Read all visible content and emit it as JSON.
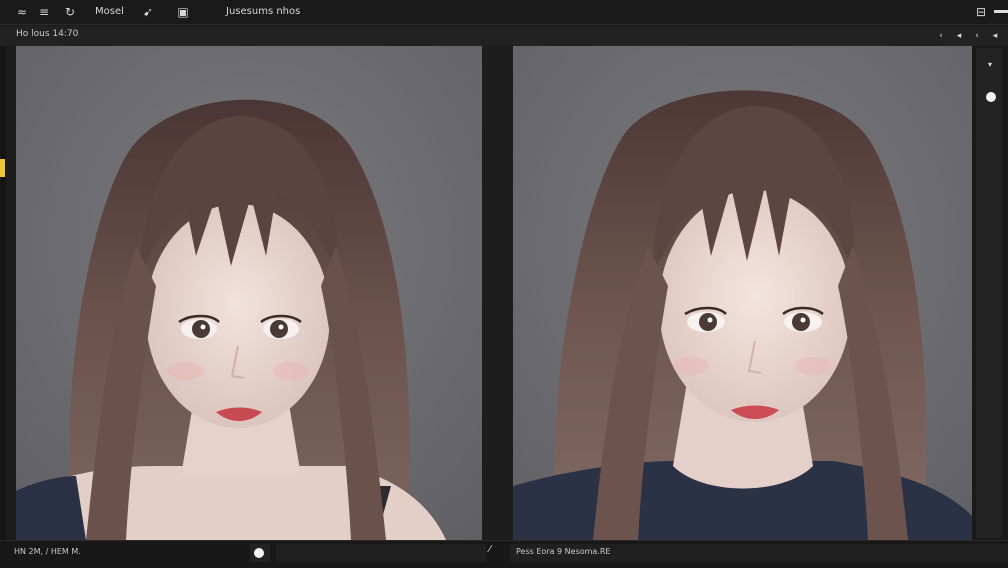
{
  "toolbar": {
    "items": [
      {
        "icon": "arrow-icon",
        "glyph": "≈"
      },
      {
        "icon": "layers-icon",
        "glyph": "≡"
      },
      {
        "icon": "refresh-icon",
        "glyph": "↻"
      },
      {
        "icon": "brush-icon",
        "glyph": "➹"
      },
      {
        "icon": "image-icon",
        "glyph": "▣"
      }
    ],
    "menu_label": "Mosel",
    "center_label": "Jusesums nhos",
    "right_icon_glyph": "⊟"
  },
  "panel": {
    "title": "Ho lous 14:70",
    "buttons": [
      "‹",
      "◂",
      "‹",
      "◂"
    ]
  },
  "bottom_bar": {
    "left_text": "HN 2M, / HEM M.",
    "right_text": "Pess Eora 9 Nesoma.RE",
    "pen_glyph": "⁄"
  },
  "colors": {
    "viewport_bg": "#6f6e72",
    "accent_marker": "#e8c833",
    "hair": "#5a4542",
    "skin": "#ead8d2",
    "shirt": "#2b3145"
  }
}
